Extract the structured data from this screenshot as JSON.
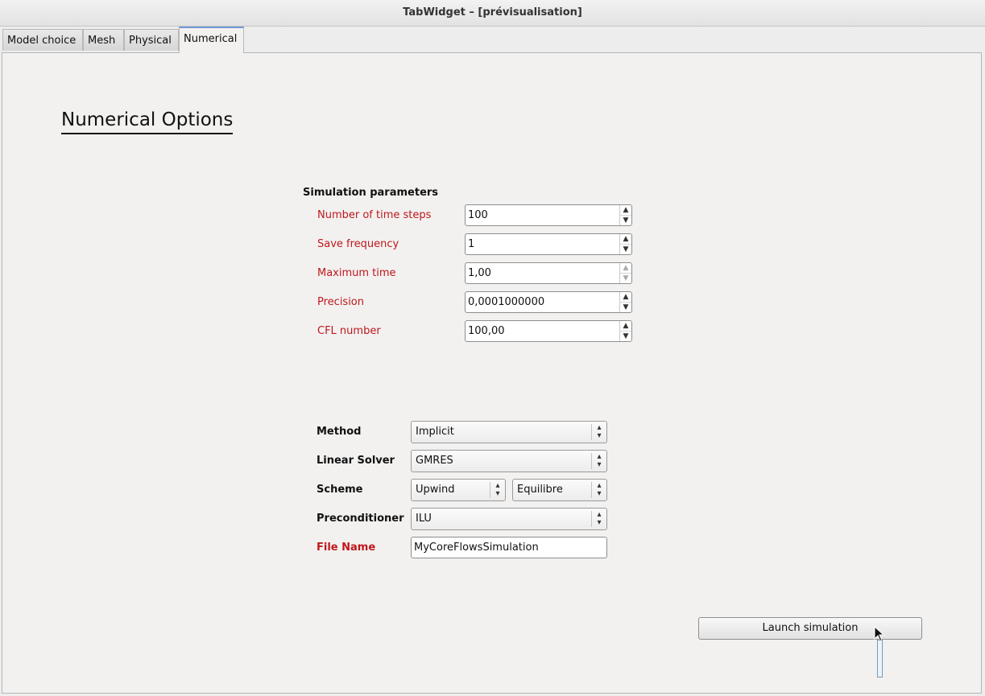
{
  "window": {
    "title": "TabWidget – [prévisualisation]"
  },
  "tabs": [
    {
      "label": "Model choice",
      "active": false
    },
    {
      "label": "Mesh",
      "active": false
    },
    {
      "label": "Physical",
      "active": false
    },
    {
      "label": "Numerical",
      "active": true
    }
  ],
  "page": {
    "heading": "Numerical Options"
  },
  "simulation_parameters": {
    "title": "Simulation parameters",
    "fields": [
      {
        "label": "Number of time steps",
        "value": "100"
      },
      {
        "label": "Save frequency",
        "value": "1"
      },
      {
        "label": "Maximum time",
        "value": "1,00"
      },
      {
        "label": "Precision",
        "value": "0,0001000000"
      },
      {
        "label": "CFL number",
        "value": "100,00"
      }
    ]
  },
  "options": {
    "method": {
      "label": "Method",
      "value": "Implicit"
    },
    "linear_solver": {
      "label": "Linear Solver",
      "value": "GMRES"
    },
    "scheme": {
      "label": "Scheme",
      "value": "Upwind",
      "value2": "Equilibre"
    },
    "preconditioner": {
      "label": "Preconditioner",
      "value": "ILU"
    },
    "file_name": {
      "label": "File Name",
      "value": "MyCoreFlowsSimulation"
    }
  },
  "actions": {
    "launch_label": "Launch simulation"
  },
  "colors": {
    "required_label": "#c0171c",
    "active_tab_accent": "#6f9ad3"
  }
}
